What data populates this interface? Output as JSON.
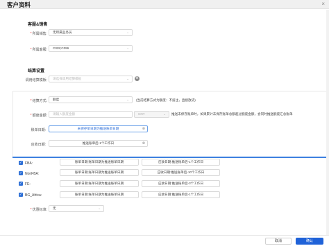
{
  "title": "客户资料",
  "section_service": "客服&销售",
  "fields_service": [
    {
      "label": "所属销售:",
      "value": "无所属业务员"
    },
    {
      "label": "所属客服:",
      "value": "C028;C096"
    }
  ],
  "section_settlement": "结算设置",
  "template": {
    "label": "调用结算模板:",
    "placeholder": "请选择调用结算模板"
  },
  "method": {
    "label": "结算方式:",
    "value": "额度",
    "note": "(当前结算方式为额度：不投注，直接放货)"
  },
  "quota": {
    "label": "额度金额:",
    "placeholder": "请输入额度金额",
    "currency": "CNY",
    "note": "推送未保存账单时，如果累计未保存账单总额超过额度金额，会同时推送额度汇总账单"
  },
  "bill_date": {
    "label": "账单日期:",
    "value": "未保存单日期为推送账单日期"
  },
  "due_date": {
    "label": "应收日期:",
    "value": "推送账单后-1个工作日"
  },
  "channels": [
    {
      "name": "FBA:",
      "bill": "账单日期:账单日期为推送账单日期",
      "due": "应收日期:推送账单后-1个工作日"
    },
    {
      "name": "NonFBA:",
      "bill": "账单日期:账单日期为推送账单日期",
      "due": "应收日期:推送账单后-10个工作日"
    },
    {
      "name": "FE:",
      "bill": "账单日期:账单日期为推送账单日期",
      "due": "应收日期:推送账单后-3个工作日"
    },
    {
      "name": "BG_Africa:",
      "bill": "账单日期:账单日期为推送账单日期",
      "due": "应收日期:推送账单后-1个工作日"
    }
  ],
  "discount": {
    "label": "优惠标准:",
    "value": "无"
  },
  "buttons": {
    "cancel": "取消",
    "ok": "确认"
  }
}
